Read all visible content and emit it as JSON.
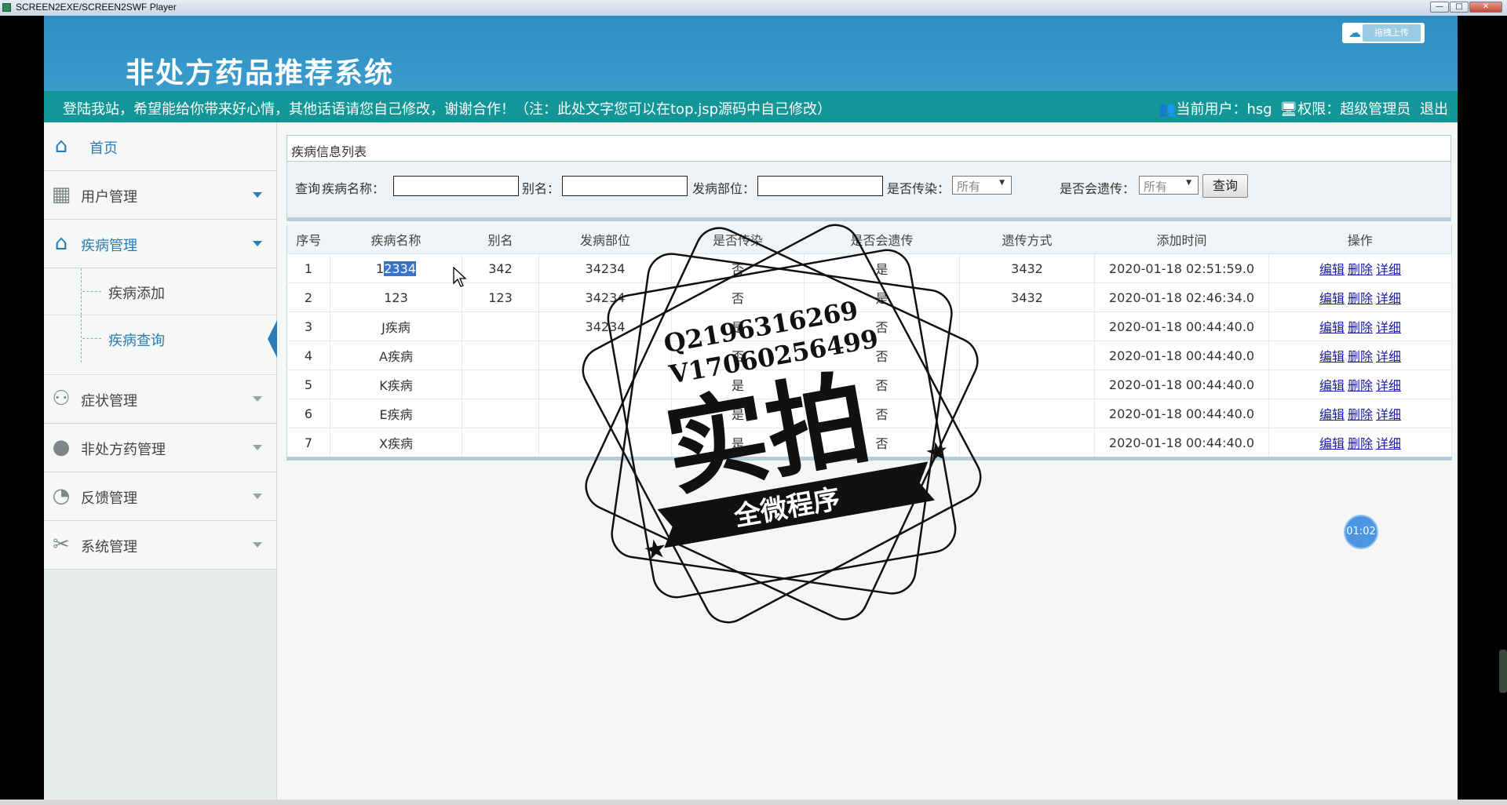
{
  "window": {
    "title": "SCREEN2EXE/SCREEN2SWF Player",
    "min": "—",
    "max": "□",
    "close": "✕"
  },
  "header": {
    "title": "非处方药品推荐系统",
    "upload_label": "拖拽上传",
    "upload_icon": "cloud-icon"
  },
  "notice": {
    "message": "登陆我站，希望能给你带来好心情，其他话语请您自己修改，谢谢合作！（注：此处文字您可以在top.jsp源码中自己修改）",
    "current_user_label": "当前用户：",
    "username": "hsg",
    "role_label": "权限：",
    "role": "超级管理员",
    "logout": "退出"
  },
  "sidebar": {
    "items": [
      {
        "label": "首页",
        "icon": "home-icon"
      },
      {
        "label": "用户管理",
        "icon": "grid-icon"
      },
      {
        "label": "疾病管理",
        "icon": "home-icon"
      },
      {
        "label": "症状管理",
        "icon": "users-icon"
      },
      {
        "label": "非处方药管理",
        "icon": "person-icon"
      },
      {
        "label": "反馈管理",
        "icon": "chat-icon"
      },
      {
        "label": "系统管理",
        "icon": "tools-icon"
      }
    ],
    "sub_items": [
      {
        "label": "疾病添加"
      },
      {
        "label": "疾病查询"
      }
    ]
  },
  "panel": {
    "title": "疾病信息列表"
  },
  "search": {
    "query_label": "查询",
    "name_label": "疾病名称：",
    "alias_label": "别名：",
    "site_label": "发病部位：",
    "contagious_label": "是否传染：",
    "contagious_value": "所有",
    "hereditary_label": "是否会遗传：",
    "hereditary_value": "所有",
    "button": "查询"
  },
  "table": {
    "columns": [
      "序号",
      "疾病名称",
      "别名",
      "发病部位",
      "是否传染",
      "是否会遗传",
      "遗传方式",
      "添加时间",
      "操作"
    ],
    "actions": [
      "编辑",
      "删除",
      "详细"
    ],
    "rows": [
      [
        "1",
        "12334",
        "342",
        "34234",
        "否",
        "是",
        "3432",
        "2020-01-18 02:51:59.0"
      ],
      [
        "2",
        "123",
        "123",
        "34234",
        "否",
        "是",
        "3432",
        "2020-01-18 02:46:34.0"
      ],
      [
        "3",
        "J疾病",
        "",
        "34234",
        "是",
        "否",
        "",
        "2020-01-18 00:44:40.0"
      ],
      [
        "4",
        "A疾病",
        "",
        "",
        "否",
        "否",
        "",
        "2020-01-18 00:44:40.0"
      ],
      [
        "5",
        "K疾病",
        "",
        "",
        "是",
        "否",
        "",
        "2020-01-18 00:44:40.0"
      ],
      [
        "6",
        "E疾病",
        "",
        "",
        "是",
        "否",
        "",
        "2020-01-18 00:44:40.0"
      ],
      [
        "7",
        "X疾病",
        "",
        "",
        "是",
        "否",
        "",
        "2020-01-18 00:44:40.0"
      ]
    ]
  },
  "watermark": {
    "contact1": "Q2196316269",
    "contact2": "V17060256499",
    "main": "实拍",
    "banner": "全微程序"
  },
  "timer": "01:02",
  "colors": {
    "header": "#3a9ccb",
    "notice": "#139697",
    "accent": "#2a7cb4",
    "link": "#1a1aa6"
  }
}
